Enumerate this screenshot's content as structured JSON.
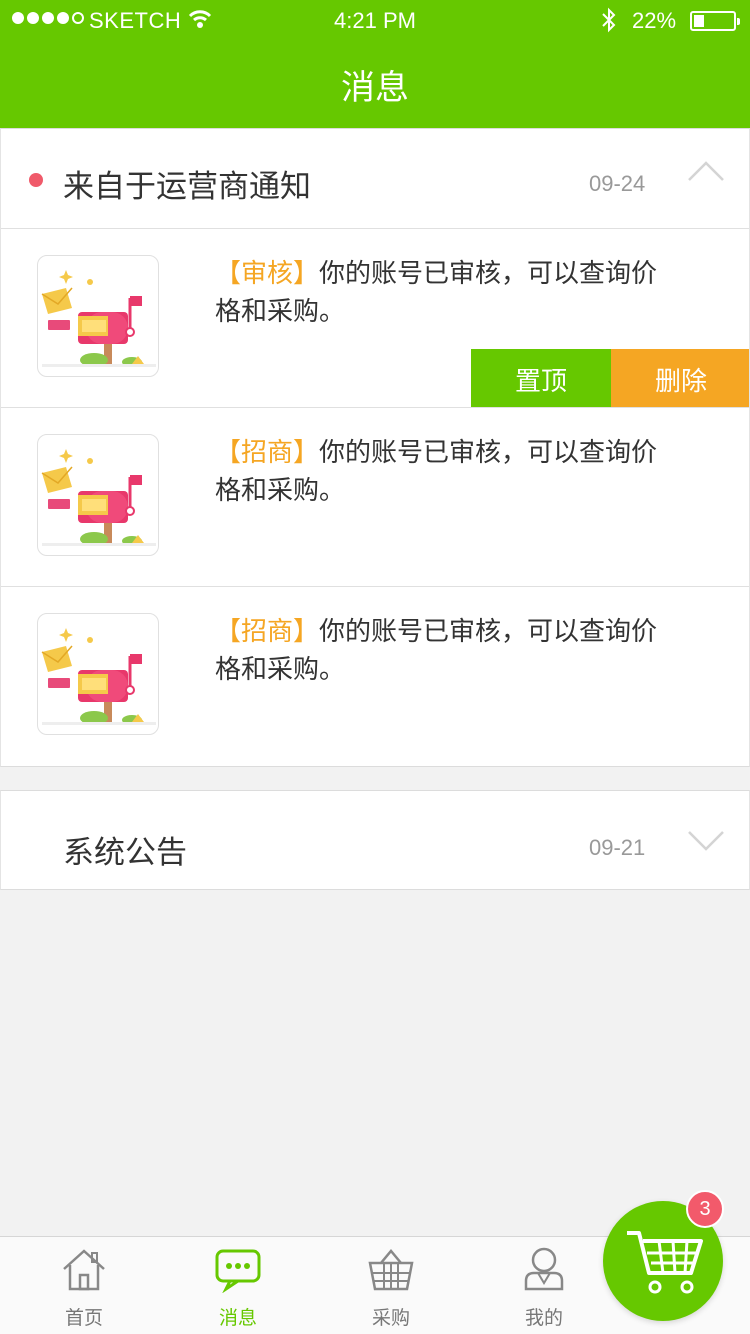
{
  "status_bar": {
    "carrier": "SKETCH",
    "time": "4:21 PM",
    "battery_pct": "22%",
    "signal_bars_filled": 4,
    "signal_bars_total": 5,
    "battery_level": 0.22
  },
  "nav": {
    "title": "消息"
  },
  "colors": {
    "brand_green": "#66c800",
    "accent_orange": "#f5a623",
    "unread_red": "#f05a6a"
  },
  "groups": [
    {
      "title": "来自于运营商通知",
      "date": "09-24",
      "unread": true,
      "expanded": true,
      "chevron_icon": "chevron-up-icon",
      "messages": [
        {
          "tag": "【审核】",
          "text": "你的账号已审核，可以查询价格和采购。",
          "thumb_icon": "mailbox-illustration",
          "actions": {
            "pin": "置顶",
            "delete": "删除"
          }
        },
        {
          "tag": "【招商】",
          "text": "你的账号已审核，可以查询价格和采购。",
          "thumb_icon": "mailbox-illustration"
        },
        {
          "tag": "【招商】",
          "text": "你的账号已审核，可以查询价格和采购。",
          "thumb_icon": "mailbox-illustration"
        }
      ]
    },
    {
      "title": "系统公告",
      "date": "09-21",
      "unread": false,
      "expanded": false,
      "chevron_icon": "chevron-down-icon"
    }
  ],
  "tabbar": {
    "tabs": [
      {
        "label": "首页",
        "icon": "home-icon",
        "active": false
      },
      {
        "label": "消息",
        "icon": "chat-bubble-icon",
        "active": true
      },
      {
        "label": "采购",
        "icon": "basket-icon",
        "active": false
      },
      {
        "label": "我的",
        "icon": "user-icon",
        "active": false
      }
    ]
  },
  "cart": {
    "icon": "shopping-cart-icon",
    "badge": "3"
  }
}
